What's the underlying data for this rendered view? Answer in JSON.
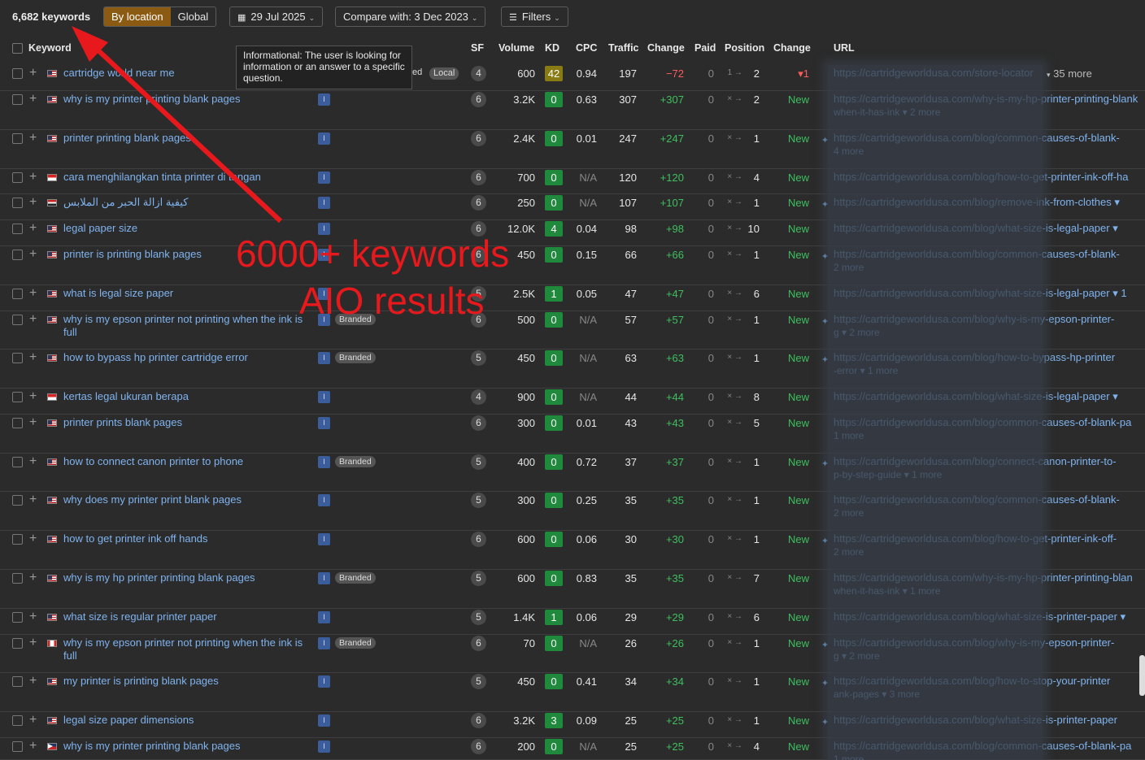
{
  "toolbar": {
    "keyword_count": "6,682 keywords",
    "by_location": "By location",
    "global": "Global",
    "date": "29 Jul 2025",
    "compare": "Compare with: 3 Dec 2023",
    "filters": "Filters"
  },
  "columns": {
    "keyword": "Keyword",
    "sf": "SF",
    "volume": "Volume",
    "kd": "KD",
    "cpc": "CPC",
    "traffic": "Traffic",
    "change": "Change",
    "paid": "Paid",
    "position": "Position",
    "pos_change": "Change",
    "url": "URL"
  },
  "tooltip": "Informational: The user is looking for information or an answer to a specific question.",
  "annotation": {
    "line1": "6000+ keywords",
    "line2": "AIO results",
    "color": "#e8191c"
  },
  "first_row_extras": {
    "ed": "ed",
    "local": "Local",
    "more": "35 more"
  },
  "rows": [
    {
      "kw": "cartridge world near me",
      "flag": "us",
      "intent": "I",
      "branded": "",
      "sf": "4",
      "vol": "600",
      "kd": "42",
      "kd_color": "yellow",
      "cpc": "0.94",
      "traffic": "197",
      "change": "−72",
      "change_sign": "neg",
      "paid": "0",
      "from": "1 →",
      "to": "2",
      "pchg": "▾1",
      "pchg_sign": "neg",
      "url": "https://cartridgeworldusa.com/store-locator",
      "url_sub": "",
      "star": false
    },
    {
      "kw": "why is my printer printing blank pages",
      "flag": "us",
      "intent": "I",
      "branded": "",
      "sf": "6",
      "vol": "3.2K",
      "kd": "0",
      "cpc": "0.63",
      "traffic": "307",
      "change": "+307",
      "change_sign": "pos",
      "paid": "0",
      "from": "× →",
      "to": "2",
      "pchg": "New",
      "pchg_sign": "new",
      "url": "https://cartridgeworldusa.com/why-is-my-hp-printer-printing-blank",
      "url_sub": "when-it-has-ink ▾  2 more",
      "star": false
    },
    {
      "kw": "printer printing blank pages",
      "flag": "us",
      "intent": "I",
      "branded": "",
      "sf": "6",
      "vol": "2.4K",
      "kd": "0",
      "cpc": "0.01",
      "traffic": "247",
      "change": "+247",
      "change_sign": "pos",
      "paid": "0",
      "from": "× →",
      "to": "1",
      "pchg": "New",
      "pchg_sign": "new",
      "url": "https://cartridgeworldusa.com/blog/common-causes-of-blank-",
      "url_sub": "4 more",
      "star": true
    },
    {
      "kw": "cara menghilangkan tinta printer di tangan",
      "flag": "id",
      "intent": "I",
      "branded": "",
      "sf": "6",
      "vol": "700",
      "kd": "0",
      "cpc": "N/A",
      "traffic": "120",
      "change": "+120",
      "change_sign": "pos",
      "paid": "0",
      "from": "× →",
      "to": "4",
      "pchg": "New",
      "pchg_sign": "new",
      "url": "https://cartridgeworldusa.com/blog/how-to-get-printer-ink-off-ha",
      "url_sub": "",
      "star": false
    },
    {
      "kw": "كيفية ازالة الحبر من الملابس",
      "flag": "eg",
      "intent": "I",
      "branded": "",
      "sf": "6",
      "vol": "250",
      "kd": "0",
      "cpc": "N/A",
      "traffic": "107",
      "change": "+107",
      "change_sign": "pos",
      "paid": "0",
      "from": "× →",
      "to": "1",
      "pchg": "New",
      "pchg_sign": "new",
      "url": "https://cartridgeworldusa.com/blog/remove-ink-from-clothes ▾",
      "url_sub": "",
      "star": true
    },
    {
      "kw": "legal paper size",
      "flag": "us",
      "intent": "I",
      "branded": "",
      "sf": "6",
      "vol": "12.0K",
      "kd": "4",
      "cpc": "0.04",
      "traffic": "98",
      "change": "+98",
      "change_sign": "pos",
      "paid": "0",
      "from": "× →",
      "to": "10",
      "pchg": "New",
      "pchg_sign": "new",
      "url": "https://cartridgeworldusa.com/blog/what-size-is-legal-paper ▾",
      "url_sub": "",
      "star": false
    },
    {
      "kw": "printer is printing blank pages",
      "flag": "us",
      "intent": "I",
      "branded": "",
      "sf": "6",
      "vol": "450",
      "kd": "0",
      "cpc": "0.15",
      "traffic": "66",
      "change": "+66",
      "change_sign": "pos",
      "paid": "0",
      "from": "× →",
      "to": "1",
      "pchg": "New",
      "pchg_sign": "new",
      "url": "https://cartridgeworldusa.com/blog/common-causes-of-blank-",
      "url_sub": "2 more",
      "star": true
    },
    {
      "kw": "what is legal size paper",
      "flag": "us",
      "intent": "I",
      "branded": "",
      "sf": "5",
      "vol": "2.5K",
      "kd": "1",
      "cpc": "0.05",
      "traffic": "47",
      "change": "+47",
      "change_sign": "pos",
      "paid": "0",
      "from": "× →",
      "to": "6",
      "pchg": "New",
      "pchg_sign": "new",
      "url": "https://cartridgeworldusa.com/blog/what-size-is-legal-paper ▾  1",
      "url_sub": "",
      "star": false
    },
    {
      "kw": "why is my epson printer not printing when the ink is full",
      "flag": "us",
      "intent": "I",
      "branded": "Branded",
      "sf": "6",
      "vol": "500",
      "kd": "0",
      "cpc": "N/A",
      "traffic": "57",
      "change": "+57",
      "change_sign": "pos",
      "paid": "0",
      "from": "× →",
      "to": "1",
      "pchg": "New",
      "pchg_sign": "new",
      "url": "https://cartridgeworldusa.com/blog/why-is-my-epson-printer-",
      "url_sub": "g ▾  2 more",
      "star": true
    },
    {
      "kw": "how to bypass hp printer cartridge error",
      "flag": "us",
      "intent": "I",
      "branded": "Branded",
      "sf": "5",
      "vol": "450",
      "kd": "0",
      "cpc": "N/A",
      "traffic": "63",
      "change": "+63",
      "change_sign": "pos",
      "paid": "0",
      "from": "× →",
      "to": "1",
      "pchg": "New",
      "pchg_sign": "new",
      "url": "https://cartridgeworldusa.com/blog/how-to-bypass-hp-printer",
      "url_sub": "-error ▾  1 more",
      "star": true
    },
    {
      "kw": "kertas legal ukuran berapa",
      "flag": "id",
      "intent": "I",
      "branded": "",
      "sf": "4",
      "vol": "900",
      "kd": "0",
      "cpc": "N/A",
      "traffic": "44",
      "change": "+44",
      "change_sign": "pos",
      "paid": "0",
      "from": "× →",
      "to": "8",
      "pchg": "New",
      "pchg_sign": "new",
      "url": "https://cartridgeworldusa.com/blog/what-size-is-legal-paper ▾",
      "url_sub": "",
      "star": false
    },
    {
      "kw": "printer prints blank pages",
      "flag": "us",
      "intent": "I",
      "branded": "",
      "sf": "6",
      "vol": "300",
      "kd": "0",
      "cpc": "0.01",
      "traffic": "43",
      "change": "+43",
      "change_sign": "pos",
      "paid": "0",
      "from": "× →",
      "to": "5",
      "pchg": "New",
      "pchg_sign": "new",
      "url": "https://cartridgeworldusa.com/blog/common-causes-of-blank-pa",
      "url_sub": "1 more",
      "star": false
    },
    {
      "kw": "how to connect canon printer to phone",
      "flag": "us",
      "intent": "I",
      "branded": "Branded",
      "sf": "5",
      "vol": "400",
      "kd": "0",
      "cpc": "0.72",
      "traffic": "37",
      "change": "+37",
      "change_sign": "pos",
      "paid": "0",
      "from": "× →",
      "to": "1",
      "pchg": "New",
      "pchg_sign": "new",
      "url": "https://cartridgeworldusa.com/blog/connect-canon-printer-to-",
      "url_sub": "p-by-step-guide ▾  1 more",
      "star": true
    },
    {
      "kw": "why does my printer print blank pages",
      "flag": "us",
      "intent": "I",
      "branded": "",
      "sf": "5",
      "vol": "300",
      "kd": "0",
      "cpc": "0.25",
      "traffic": "35",
      "change": "+35",
      "change_sign": "pos",
      "paid": "0",
      "from": "× →",
      "to": "1",
      "pchg": "New",
      "pchg_sign": "new",
      "url": "https://cartridgeworldusa.com/blog/common-causes-of-blank-",
      "url_sub": "2 more",
      "star": false
    },
    {
      "kw": "how to get printer ink off hands",
      "flag": "us",
      "intent": "I",
      "branded": "",
      "sf": "6",
      "vol": "600",
      "kd": "0",
      "cpc": "0.06",
      "traffic": "30",
      "change": "+30",
      "change_sign": "pos",
      "paid": "0",
      "from": "× →",
      "to": "1",
      "pchg": "New",
      "pchg_sign": "new",
      "url": "https://cartridgeworldusa.com/blog/how-to-get-printer-ink-off-",
      "url_sub": "2 more",
      "star": true
    },
    {
      "kw": "why is my hp printer printing blank pages",
      "flag": "us",
      "intent": "I",
      "branded": "Branded",
      "sf": "5",
      "vol": "600",
      "kd": "0",
      "cpc": "0.83",
      "traffic": "35",
      "change": "+35",
      "change_sign": "pos",
      "paid": "0",
      "from": "× →",
      "to": "7",
      "pchg": "New",
      "pchg_sign": "new",
      "url": "https://cartridgeworldusa.com/why-is-my-hp-printer-printing-blan",
      "url_sub": "when-it-has-ink ▾  1 more",
      "star": false
    },
    {
      "kw": "what size is regular printer paper",
      "flag": "us",
      "intent": "I",
      "branded": "",
      "sf": "5",
      "vol": "1.4K",
      "kd": "1",
      "cpc": "0.06",
      "traffic": "29",
      "change": "+29",
      "change_sign": "pos",
      "paid": "0",
      "from": "× →",
      "to": "6",
      "pchg": "New",
      "pchg_sign": "new",
      "url": "https://cartridgeworldusa.com/blog/what-size-is-printer-paper ▾",
      "url_sub": "",
      "star": false
    },
    {
      "kw": "why is my epson printer not printing when the ink is full",
      "flag": "ca",
      "intent": "I",
      "branded": "Branded",
      "sf": "6",
      "vol": "70",
      "kd": "0",
      "cpc": "N/A",
      "traffic": "26",
      "change": "+26",
      "change_sign": "pos",
      "paid": "0",
      "from": "× →",
      "to": "1",
      "pchg": "New",
      "pchg_sign": "new",
      "url": "https://cartridgeworldusa.com/blog/why-is-my-epson-printer-",
      "url_sub": "g ▾  2 more",
      "star": true
    },
    {
      "kw": "my printer is printing blank pages",
      "flag": "us",
      "intent": "I",
      "branded": "",
      "sf": "5",
      "vol": "450",
      "kd": "0",
      "cpc": "0.41",
      "traffic": "34",
      "change": "+34",
      "change_sign": "pos",
      "paid": "0",
      "from": "× →",
      "to": "1",
      "pchg": "New",
      "pchg_sign": "new",
      "url": "https://cartridgeworldusa.com/blog/how-to-stop-your-printer",
      "url_sub": "ank-pages ▾  3 more",
      "star": true
    },
    {
      "kw": "legal size paper dimensions",
      "flag": "us",
      "intent": "I",
      "branded": "",
      "sf": "6",
      "vol": "3.2K",
      "kd": "3",
      "cpc": "0.09",
      "traffic": "25",
      "change": "+25",
      "change_sign": "pos",
      "paid": "0",
      "from": "× →",
      "to": "1",
      "pchg": "New",
      "pchg_sign": "new",
      "url": "https://cartridgeworldusa.com/blog/what-size-is-printer-paper",
      "url_sub": "",
      "star": true
    },
    {
      "kw": "why is my printer printing blank pages",
      "flag": "ph",
      "intent": "I",
      "branded": "",
      "sf": "6",
      "vol": "200",
      "kd": "0",
      "cpc": "N/A",
      "traffic": "25",
      "change": "+25",
      "change_sign": "pos",
      "paid": "0",
      "from": "× →",
      "to": "4",
      "pchg": "New",
      "pchg_sign": "new",
      "url": "https://cartridgeworldusa.com/blog/common-causes-of-blank-pa",
      "url_sub": "1 more",
      "star": false
    }
  ]
}
